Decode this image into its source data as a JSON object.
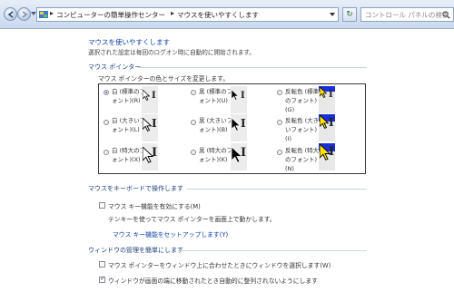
{
  "window": {
    "title": "マウスを使いやすくします"
  },
  "address_bar": {
    "segments": [
      "コンピューターの簡単操作センター",
      "マウスを使いやすくします"
    ],
    "separator": "▸",
    "icon": "control-panel-icon"
  },
  "search": {
    "placeholder": "コントロール パネルの検索",
    "icon": "search-icon"
  },
  "page": {
    "title": "マウスを使いやすくします",
    "subtitle": "選択された設定は毎回のログオン時に自動的に開始されます。"
  },
  "pointer_section": {
    "heading": "マウス ポインター",
    "description": "マウス ポインターの色とサイズを変更します。",
    "options": [
      {
        "label": [
          "白 (標準のフ",
          "ォント)(R)"
        ],
        "selected": true,
        "style": "white",
        "size": "small"
      },
      {
        "label": [
          "黒 (標準のフ",
          "ォント)(U)"
        ],
        "selected": false,
        "style": "black",
        "size": "small"
      },
      {
        "label": [
          "反転色 (標準",
          "のフォント)",
          "(G)"
        ],
        "selected": false,
        "style": "inverted",
        "size": "small"
      },
      {
        "label": [
          "白 (大きいフ",
          "ォント)(L)"
        ],
        "selected": false,
        "style": "white",
        "size": "medium"
      },
      {
        "label": [
          "黒 (大きいフ",
          "ォント)(B)"
        ],
        "selected": false,
        "style": "black",
        "size": "medium"
      },
      {
        "label": [
          "反転色 (大き",
          "いフォント)",
          "(I)"
        ],
        "selected": false,
        "style": "inverted",
        "size": "medium"
      },
      {
        "label": [
          "白 (特大のフ",
          "ォント)(X)"
        ],
        "selected": false,
        "style": "white",
        "size": "large"
      },
      {
        "label": [
          "黒 (特大のフ",
          "ォント)(K)"
        ],
        "selected": false,
        "style": "black",
        "size": "large"
      },
      {
        "label": [
          "反転色 (特大",
          "のフォント)",
          "(N)"
        ],
        "selected": false,
        "style": "inverted",
        "size": "large"
      }
    ]
  },
  "keyboard_section": {
    "heading": "マウスをキーボードで操作します",
    "mouse_keys_label": "マウス キー機能を有効にする(M)",
    "mouse_keys_checked": false,
    "mouse_keys_desc": "テンキーを使ってマウス ポインターを画面上で動かします。",
    "setup_link": "マウス キー機能をセットアップします(Y)"
  },
  "window_section": {
    "heading": "ウィンドウの管理を簡単にします",
    "hover_activate_label": "マウス ポインターをウィンドウ上に合わせたときにウィンドウを選択します(W)",
    "hover_activate_checked": false,
    "prevent_snap_label": "ウィンドウが画面の端に移動されたとき自動的に整列されないようにします",
    "prevent_snap_checked": true
  },
  "colors": {
    "link": "#0a3fa8",
    "accent_blue": "#1a2fd6",
    "selected_radio": "#3566c8"
  }
}
